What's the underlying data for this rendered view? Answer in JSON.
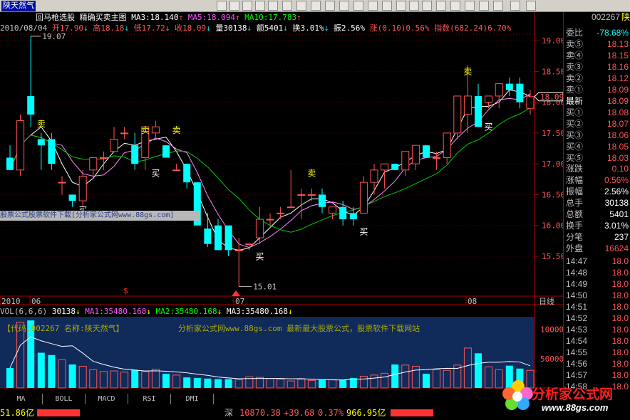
{
  "stock": {
    "name": "陕天然气",
    "code": "002267",
    "code_short": "陕"
  },
  "title_bar": {
    "indicator": "回马枪选股",
    "desc": "精确买卖主图",
    "ma3": "MA3:18.140",
    "ma5": "MA5:18.094",
    "ma10": "MA10:17.783"
  },
  "info_bar": {
    "date": "2010/08/04",
    "open": "开17.90",
    "high": "高18.18",
    "low": "低17.72",
    "close": "收18.09",
    "volume": "量30138",
    "amount": "额5401",
    "turnover": "换3.01%",
    "amplitude": "振2.56%",
    "change": "涨(0.10)0.56%",
    "index": "指数(682.24)6.70%"
  },
  "price_axis": [
    "19.00",
    "18.50",
    "18.00",
    "17.50",
    "17.00",
    "16.50",
    "16.00",
    "15.50"
  ],
  "price_marker": "18.09",
  "max_label": "19.07",
  "min_label": "15.01",
  "date_labels": [
    "2010",
    "06",
    "07",
    "08"
  ],
  "period_label": "日线",
  "vol_bar": {
    "name": "VOL(6,6,6)",
    "vol": "30138",
    "ma1": "MA1:35480.168",
    "ma2": "MA2:35480.168",
    "ma3": "MA3:35480.168"
  },
  "vol_axis": [
    "100000",
    "50000"
  ],
  "vol_banner": {
    "left": "【代码:002267 名称:陕天然气】",
    "center": "分析家公式网www.88gs.com 最新最大股票公式，股票软件下载网站"
  },
  "watermark": "股票公式股票软件下载[分析家公式网www.88gs.com]",
  "signals": {
    "sell": "卖",
    "buy": "买"
  },
  "order_book": {
    "ratio_label": "委比",
    "ratio_value": "-78.68%",
    "asks": [
      {
        "label": "卖⑤",
        "price": "18.13"
      },
      {
        "label": "卖④",
        "price": "18.15"
      },
      {
        "label": "卖③",
        "price": "18.16"
      },
      {
        "label": "卖②",
        "price": "18.12"
      },
      {
        "label": "卖①",
        "price": "18.09"
      }
    ],
    "last_label": "最新",
    "last_value": "18.09",
    "bids": [
      {
        "label": "买①",
        "price": "18.08"
      },
      {
        "label": "买②",
        "price": "18.07"
      },
      {
        "label": "买③",
        "price": "18.06"
      },
      {
        "label": "买④",
        "price": "18.05"
      },
      {
        "label": "买⑤",
        "price": "18.03"
      }
    ]
  },
  "stats": [
    {
      "label": "涨跌",
      "value": "0.10",
      "color": "#ff5555"
    },
    {
      "label": "涨幅",
      "value": "0.56%",
      "color": "#ff5555"
    },
    {
      "label": "振幅",
      "value": "2.56%",
      "color": "#ffffff"
    },
    {
      "label": "总手",
      "value": "30138",
      "color": "#ffffff"
    },
    {
      "label": "总额",
      "value": "5401",
      "color": "#ffffff"
    },
    {
      "label": "换手",
      "value": "3.01%",
      "color": "#ffffff"
    },
    {
      "label": "分笔",
      "value": "237",
      "color": "#ffffff"
    }
  ],
  "outer_disk": {
    "label": "外盘",
    "value": "16624"
  },
  "ticks": [
    {
      "time": "14:47",
      "price": "18.0"
    },
    {
      "time": "14:48",
      "price": "18.0"
    },
    {
      "time": "14:49",
      "price": "18.0"
    },
    {
      "time": "14:50",
      "price": "18.0"
    },
    {
      "time": "14:51",
      "price": "18.0"
    },
    {
      "time": "14:52",
      "price": "18.0"
    },
    {
      "time": "14:53",
      "price": "18.0"
    },
    {
      "time": "14:54",
      "price": "18.0"
    },
    {
      "time": "14:55",
      "price": "18.0"
    },
    {
      "time": "14:56",
      "price": "18.0"
    },
    {
      "time": "14:57",
      "price": "18.0"
    },
    {
      "time": "14:58",
      "price": "18.0"
    }
  ],
  "tabs": [
    "MA",
    "BOLL",
    "MACD",
    "RSI",
    "DMI"
  ],
  "status": {
    "left_amount": "51.86亿",
    "market": "深",
    "index": "10870.38",
    "change": "+39.68",
    "pct": "0.37%",
    "amount": "966.95亿"
  },
  "logo": {
    "text": "分析家公式网",
    "url": "www.88gs.com"
  },
  "colors": {
    "up": "#ff5555",
    "down": "#00ffff",
    "ma3": "#ffffff",
    "ma5": "#ff88ff",
    "ma10": "#00cc00",
    "vol_panel": "#102a5a"
  },
  "chart_data": {
    "type": "candlestick",
    "price_range": [
      15.01,
      19.07
    ],
    "candles": [
      {
        "o": 17.1,
        "h": 17.3,
        "l": 16.9,
        "c": 16.9
      },
      {
        "o": 16.9,
        "h": 17.8,
        "l": 16.8,
        "c": 17.7
      },
      {
        "o": 18.1,
        "h": 19.07,
        "l": 17.6,
        "c": 17.8
      },
      {
        "o": 17.4,
        "h": 17.5,
        "l": 16.9,
        "c": 17.3
      },
      {
        "o": 17.4,
        "h": 17.5,
        "l": 16.9,
        "c": 17.0
      },
      {
        "o": 16.7,
        "h": 16.8,
        "l": 16.5,
        "c": 16.7
      },
      {
        "o": 16.5,
        "h": 16.5,
        "l": 16.3,
        "c": 16.4
      },
      {
        "o": 16.4,
        "h": 16.9,
        "l": 16.3,
        "c": 16.8
      },
      {
        "o": 16.9,
        "h": 17.1,
        "l": 16.8,
        "c": 17.1
      },
      {
        "o": 17.1,
        "h": 17.2,
        "l": 16.9,
        "c": 17.1
      },
      {
        "o": 17.2,
        "h": 17.6,
        "l": 17.2,
        "c": 17.4
      },
      {
        "o": 17.5,
        "h": 17.6,
        "l": 17.4,
        "c": 17.5
      },
      {
        "o": 17.3,
        "h": 17.5,
        "l": 16.9,
        "c": 17.0
      },
      {
        "o": 17.1,
        "h": 17.6,
        "l": 16.9,
        "c": 17.6
      },
      {
        "o": 17.5,
        "h": 17.7,
        "l": 17.4,
        "c": 17.6
      },
      {
        "o": 17.3,
        "h": 17.3,
        "l": 17.1,
        "c": 17.1
      },
      {
        "o": 16.9,
        "h": 17.0,
        "l": 16.9,
        "c": 16.9
      },
      {
        "o": 17.0,
        "h": 17.0,
        "l": 16.6,
        "c": 16.7
      },
      {
        "o": 16.7,
        "h": 16.7,
        "l": 16.0,
        "c": 16.0
      },
      {
        "o": 15.95,
        "h": 16.2,
        "l": 15.65,
        "c": 15.7
      },
      {
        "o": 16.0,
        "h": 16.1,
        "l": 15.6,
        "c": 15.6
      },
      {
        "o": 16.0,
        "h": 16.0,
        "l": 15.5,
        "c": 15.6
      },
      {
        "o": 15.6,
        "h": 15.8,
        "l": 15.01,
        "c": 15.6
      },
      {
        "o": 15.7,
        "h": 15.7,
        "l": 15.6,
        "c": 15.7
      },
      {
        "o": 15.8,
        "h": 16.3,
        "l": 15.7,
        "c": 16.1
      },
      {
        "o": 16.1,
        "h": 16.2,
        "l": 16.0,
        "c": 16.1
      },
      {
        "o": 16.2,
        "h": 16.3,
        "l": 16.1,
        "c": 16.2
      },
      {
        "o": 16.3,
        "h": 16.9,
        "l": 16.3,
        "c": 16.3
      },
      {
        "o": 16.5,
        "h": 16.6,
        "l": 16.1,
        "c": 16.5
      },
      {
        "o": 16.5,
        "h": 16.6,
        "l": 16.4,
        "c": 16.5
      },
      {
        "o": 16.5,
        "h": 16.6,
        "l": 16.2,
        "c": 16.3
      },
      {
        "o": 16.2,
        "h": 16.3,
        "l": 16.1,
        "c": 16.3
      },
      {
        "o": 16.3,
        "h": 16.4,
        "l": 16.0,
        "c": 16.1
      },
      {
        "o": 16.2,
        "h": 16.3,
        "l": 16.0,
        "c": 16.1
      },
      {
        "o": 16.2,
        "h": 16.8,
        "l": 16.2,
        "c": 16.7
      },
      {
        "o": 16.7,
        "h": 17.0,
        "l": 16.5,
        "c": 16.9
      },
      {
        "o": 16.9,
        "h": 17.0,
        "l": 16.6,
        "c": 17.0
      },
      {
        "o": 17.0,
        "h": 17.0,
        "l": 16.9,
        "c": 16.9
      },
      {
        "o": 16.9,
        "h": 17.0,
        "l": 16.8,
        "c": 17.2
      },
      {
        "o": 17.0,
        "h": 17.3,
        "l": 16.9,
        "c": 17.3
      },
      {
        "o": 17.3,
        "h": 17.3,
        "l": 17.1,
        "c": 17.1
      },
      {
        "o": 17.1,
        "h": 17.2,
        "l": 16.9,
        "c": 17.1
      },
      {
        "o": 17.1,
        "h": 17.5,
        "l": 17.0,
        "c": 17.5
      },
      {
        "o": 17.5,
        "h": 18.1,
        "l": 17.4,
        "c": 18.1
      },
      {
        "o": 17.8,
        "h": 18.6,
        "l": 17.5,
        "c": 18.1
      },
      {
        "o": 18.1,
        "h": 18.3,
        "l": 17.6,
        "c": 17.6
      },
      {
        "o": 18.0,
        "h": 18.1,
        "l": 17.9,
        "c": 18.1
      },
      {
        "o": 18.1,
        "h": 18.3,
        "l": 17.9,
        "c": 18.3
      },
      {
        "o": 18.3,
        "h": 18.4,
        "l": 18.1,
        "c": 18.2
      },
      {
        "o": 18.3,
        "h": 18.4,
        "l": 17.9,
        "c": 18.0
      },
      {
        "o": 17.9,
        "h": 18.2,
        "l": 17.8,
        "c": 18.09
      }
    ],
    "volumes": [
      34000,
      112000,
      115000,
      60000,
      56000,
      48000,
      40000,
      37000,
      31000,
      28000,
      29000,
      27000,
      31000,
      28000,
      32000,
      24000,
      22000,
      18000,
      17000,
      16000,
      15000,
      15000,
      14000,
      19000,
      18000,
      16000,
      15000,
      12000,
      15000,
      13000,
      14000,
      14000,
      14000,
      17000,
      20000,
      22000,
      25000,
      40000,
      39000,
      37000,
      24000,
      31000,
      30000,
      39000,
      68000,
      59000,
      36000,
      31000,
      38000,
      33000,
      30000
    ]
  }
}
